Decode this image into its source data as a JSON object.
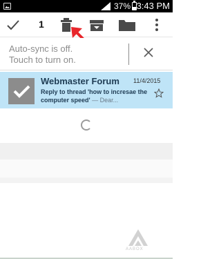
{
  "status_bar": {
    "battery": "37%",
    "time": "3:43 PM"
  },
  "toolbar": {
    "selected_count": "1",
    "icons": [
      "done-check-icon",
      "delete-trash-icon",
      "archive-box-icon",
      "move-folder-icon",
      "more-vert-icon"
    ]
  },
  "sync_banner": {
    "line1": "Auto-sync is off.",
    "line2": "Touch to turn on."
  },
  "email": {
    "sender": "Webmaster Forum",
    "date": "11/4/2015",
    "subject": "Reply to thread 'how to incresae the computer speed'",
    "preview": " — Dear..."
  },
  "watermark": {
    "text": "AABOX"
  },
  "colors": {
    "selected_row": "#bfe4f7",
    "arrow": "#e8262b",
    "status_bar": "#000000",
    "check_tile": "#8c8c8c"
  }
}
